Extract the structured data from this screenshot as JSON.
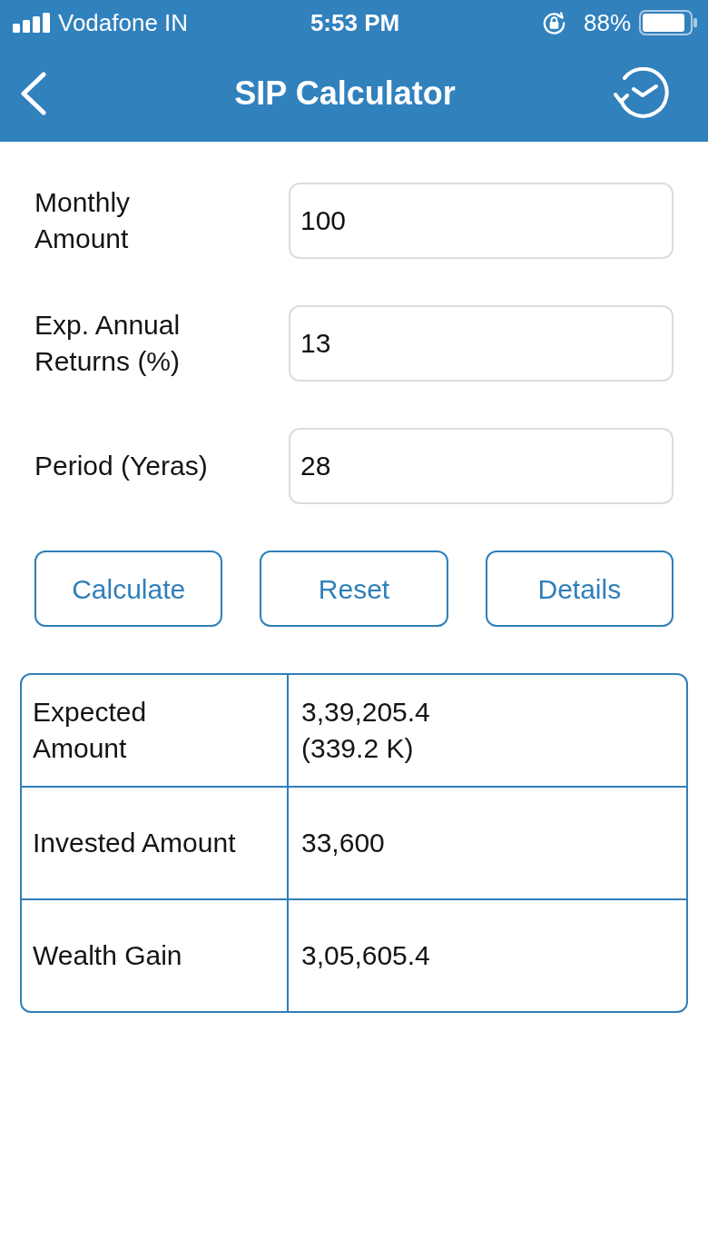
{
  "status_bar": {
    "carrier": "Vodafone IN",
    "time": "5:53 PM",
    "battery": "88%"
  },
  "nav_bar": {
    "title": "SIP Calculator"
  },
  "fields": [
    {
      "label": "Monthly Amount",
      "value": "100"
    },
    {
      "label": "Exp. Annual Returns (%)",
      "value": "13"
    },
    {
      "label": "Period (Yeras)",
      "value": "28"
    }
  ],
  "buttons": [
    "Calculate",
    "Reset",
    "Details"
  ],
  "results": [
    {
      "label": "Expected Amount",
      "value": "3,39,205.4\n(339.2 K)"
    },
    {
      "label": "Invested Amount",
      "value": "33,600"
    },
    {
      "label": "Wealth Gain",
      "value": "3,05,605.4"
    }
  ]
}
